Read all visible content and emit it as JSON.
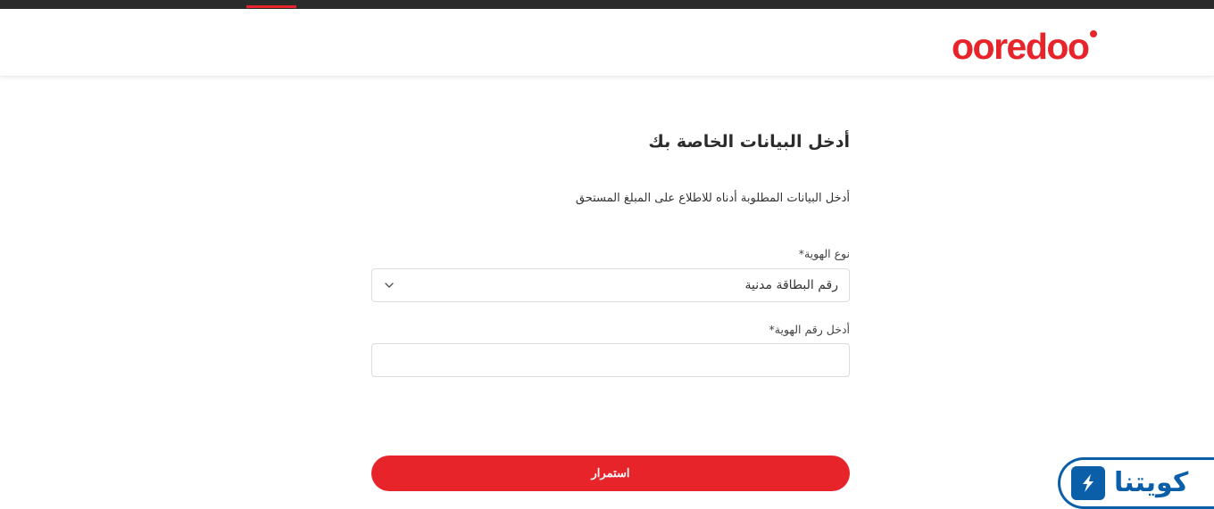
{
  "header": {
    "logo_text": "ooredoo"
  },
  "form": {
    "title": "أدخل البيانات الخاصة بك",
    "subtitle": "أدخل البيانات المطلوبة أدناه للاطلاع على المبلغ المستحق",
    "id_type": {
      "label": "نوع الهوية*",
      "selected_value": "رقم البطاقة مدنية",
      "chevron_icon": "chevron-down-icon"
    },
    "id_number": {
      "label": "أدخل رقم الهوية*",
      "value": "",
      "placeholder": ""
    },
    "continue_label": "استمرار"
  },
  "watermark": {
    "text": "كويتنا",
    "icon": "lightning-icon"
  },
  "colors": {
    "brand_red": "#e8242b",
    "topbar": "#2a2a2a",
    "watermark_blue": "#0b5fa8"
  }
}
